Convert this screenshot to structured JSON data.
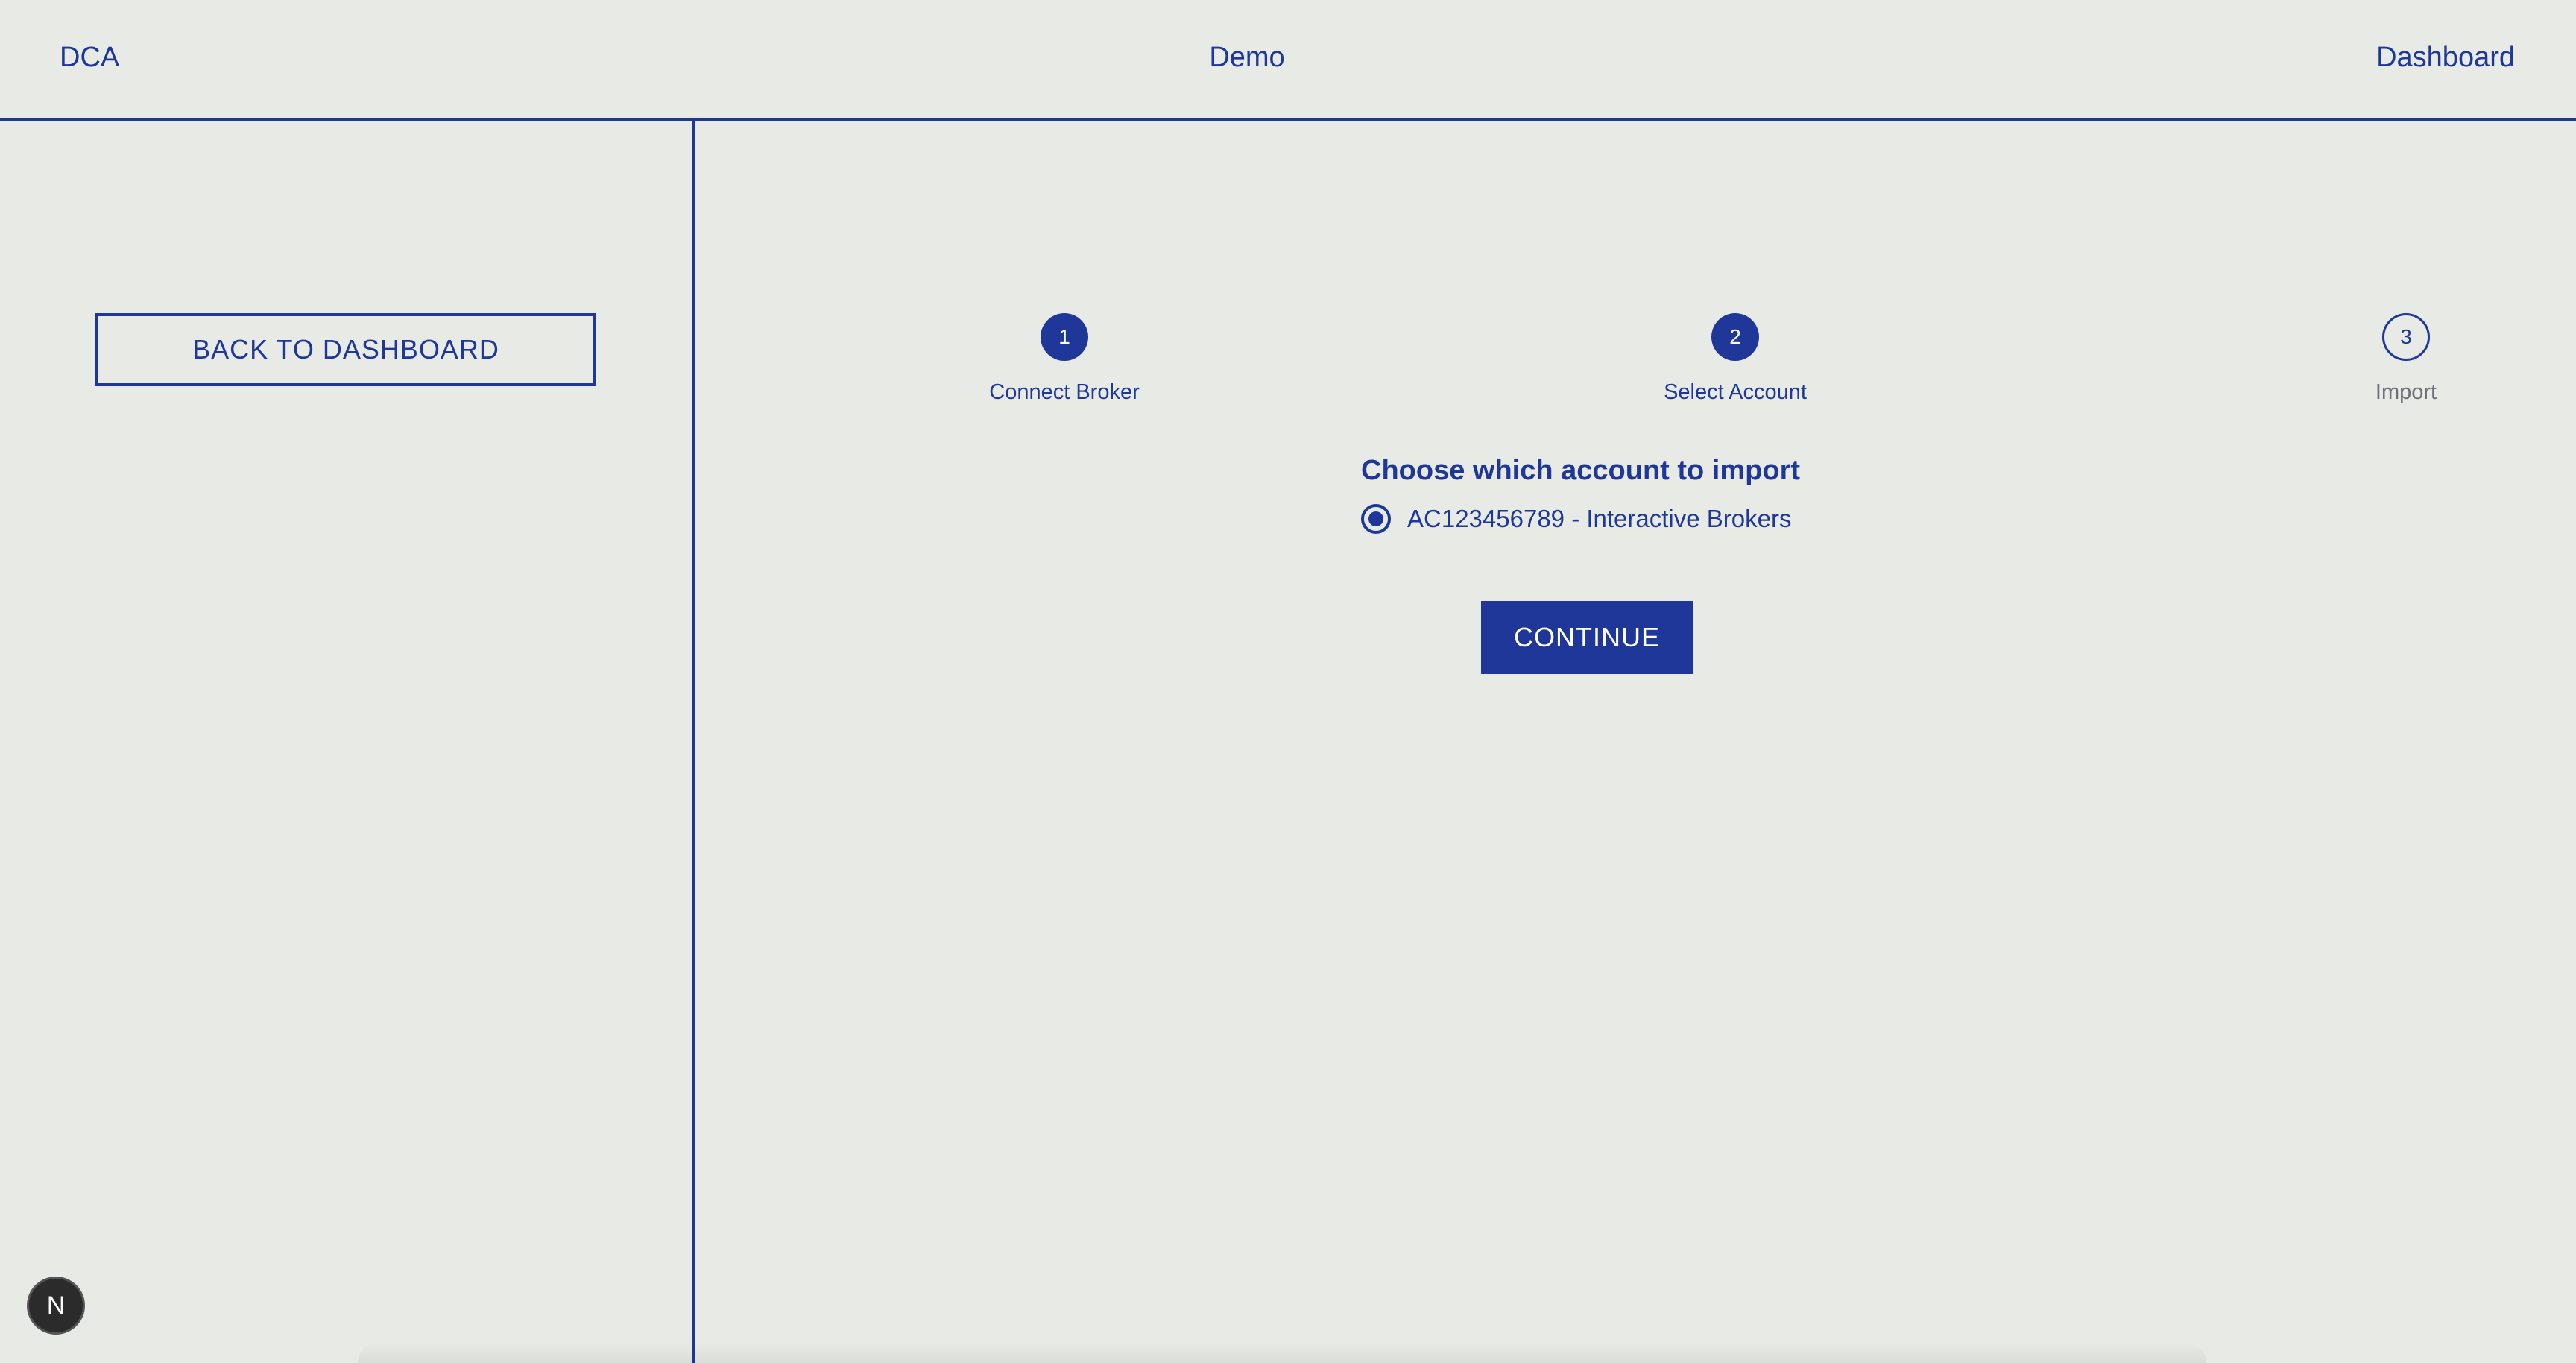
{
  "header": {
    "brand": "DCA",
    "title": "Demo",
    "dashboard_link": "Dashboard"
  },
  "sidebar": {
    "back_button": "BACK TO DASHBOARD"
  },
  "stepper": {
    "steps": [
      {
        "number": "1",
        "label": "Connect Broker",
        "state": "complete"
      },
      {
        "number": "2",
        "label": "Select Account",
        "state": "active"
      },
      {
        "number": "3",
        "label": "Import",
        "state": "pending"
      }
    ]
  },
  "account_selection": {
    "heading": "Choose which account to import",
    "options": [
      {
        "label": "AC123456789 - Interactive Brokers",
        "selected": true
      }
    ],
    "continue_button": "CONTINUE"
  },
  "dev_badge": {
    "letter": "N"
  },
  "colors": {
    "background": "#e8ebe5",
    "accent": "#1e3799",
    "muted_text": "#6b6f78"
  }
}
